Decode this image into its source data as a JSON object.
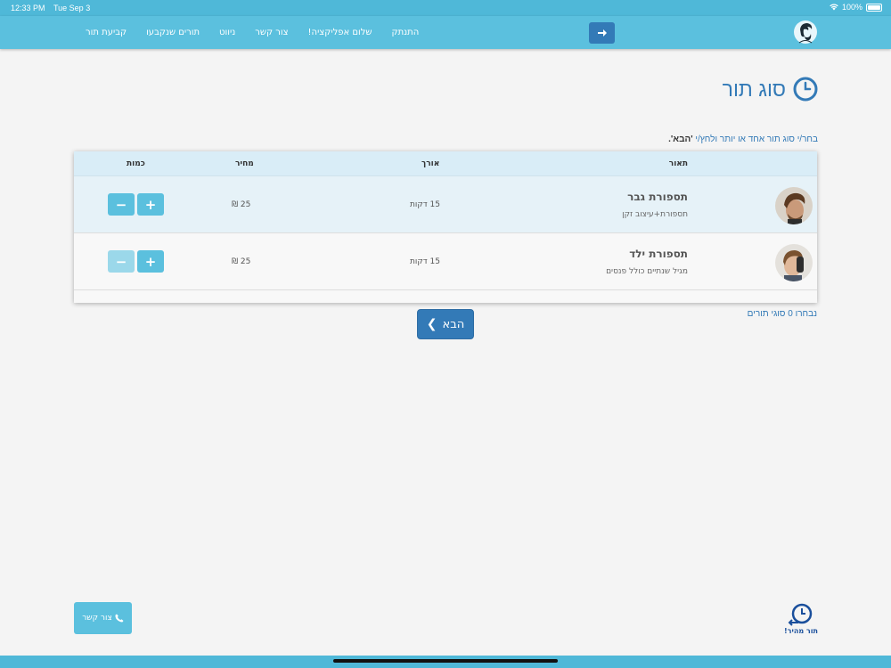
{
  "status_bar": {
    "time": "12:33 PM",
    "date": "Tue Sep 3",
    "battery": "100%"
  },
  "navbar": {
    "links": [
      "קביעת תור",
      "תורים שנקבעו",
      "ניווט",
      "צור קשר",
      "שלום אפליקציה!",
      "התנתק"
    ],
    "arrow_icon": "arrow-right-icon"
  },
  "page": {
    "title": "סוג תור",
    "instruction_prefix": "בחר/י סוג תור אחד או יותר ולחץ/י ",
    "instruction_bold": "'הבא'.",
    "selected_count": "נבחרו 0 סוגי תורים",
    "next_label": "הבא"
  },
  "table": {
    "headers": {
      "description": "תאור",
      "duration": "אורך",
      "price": "מחיר",
      "quantity": "כמות"
    },
    "rows": [
      {
        "name": "תספורת גבר",
        "desc": "תספורת+עיצוב זקן",
        "duration": "15 דקות",
        "price": "25 ₪",
        "minus_disabled": false
      },
      {
        "name": "תספורת ילד",
        "desc": "מגיל שנתיים כולל פנסים",
        "duration": "15 דקות",
        "price": "25 ₪",
        "minus_disabled": true
      }
    ],
    "plus_symbol": "+",
    "minus_symbol": "−"
  },
  "footer": {
    "contact_label": "צור קשר",
    "quick_label": "תור מהיר!"
  },
  "colors": {
    "nav": "#5bc0de",
    "primary": "#337ab7",
    "header": "#d9edf7"
  }
}
